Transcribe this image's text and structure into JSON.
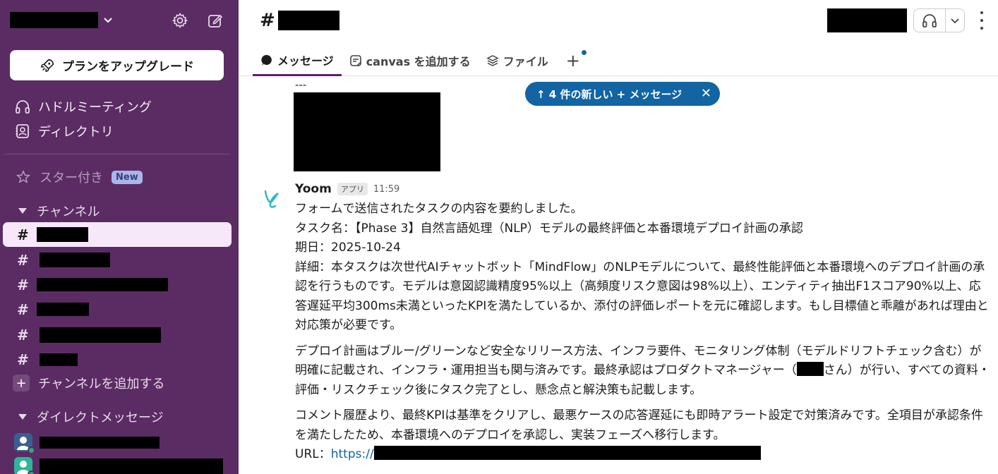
{
  "sidebar": {
    "upgrade_label": "プランをアップグレード",
    "nav": [
      {
        "label": "ハドルミーティング",
        "icon": "headphones-icon"
      },
      {
        "label": "ディレクトリ",
        "icon": "directory-icon"
      }
    ],
    "starred_label": "スター付き",
    "new_badge": "New",
    "channels_section": "チャンネル",
    "add_channel_label": "チャンネルを追加する",
    "dm_section": "ダイレクトメッセージ"
  },
  "header": {
    "hash": "#",
    "tabs": [
      {
        "label": "メッセージ",
        "icon": "message-icon",
        "active": true
      },
      {
        "label": "canvas を追加する",
        "icon": "canvas-icon",
        "active": false
      },
      {
        "label": "ファイル",
        "icon": "files-icon",
        "active": false
      }
    ]
  },
  "messages": {
    "divider_text": "---",
    "new_pill": "↑ 4 件の新しい + メッセージ",
    "sender": "Yoom",
    "app_badge": "アプリ",
    "time": "11:59",
    "lines": [
      "フォームで送信されたタスクの内容を要約しました。",
      "タスク名：【Phase 3】自然言語処理（NLP）モデルの最終評価と本番環境デプロイ計画の承認",
      "期日：2025-10-24",
      "詳細：本タスクは次世代AIチャットボット「MindFlow」のNLPモデルについて、最終性能評価と本番環境へのデプロイ計画の承認を行うものです。モデルは意図認識精度95%以上（高頻度リスク意図は98%以上）、エンティティ抽出F1スコア90%以上、応答遅延平均300ms未満といったKPIを満たしているか、添付の評価レポートを元に確認します。もし目標値と乖離があれば理由と対応策が必要です。"
    ],
    "para2_a": "デプロイ計画はブルー/グリーンなど安全なリリース方法、インフラ要件、モニタリング体制（モデルドリフトチェック含む）が明確に記載され、インフラ・運用担当も関与済みです。最終承認はプロダクトマネージャー（",
    "para2_b": "さん）が行い、すべての資料・評価・リスクチェック後にタスク完了とし、懸念点と解決策も記載します。",
    "para3": "コメント履歴より、最終KPIは基準をクリアし、最悪ケースの応答遅延にも即時アラート設定で対策済みです。全項目が承認条件を満たしたため、本番環境へのデプロイを承認し、実装フェーズへ移行します。",
    "url_label": "URL：",
    "url_prefix": "https://"
  },
  "colors": {
    "sidebar_bg": "#5b2c63",
    "active_channel_bg": "#f6e8f9",
    "accent_blue": "#1264a3",
    "tab_underline": "#611f69"
  }
}
